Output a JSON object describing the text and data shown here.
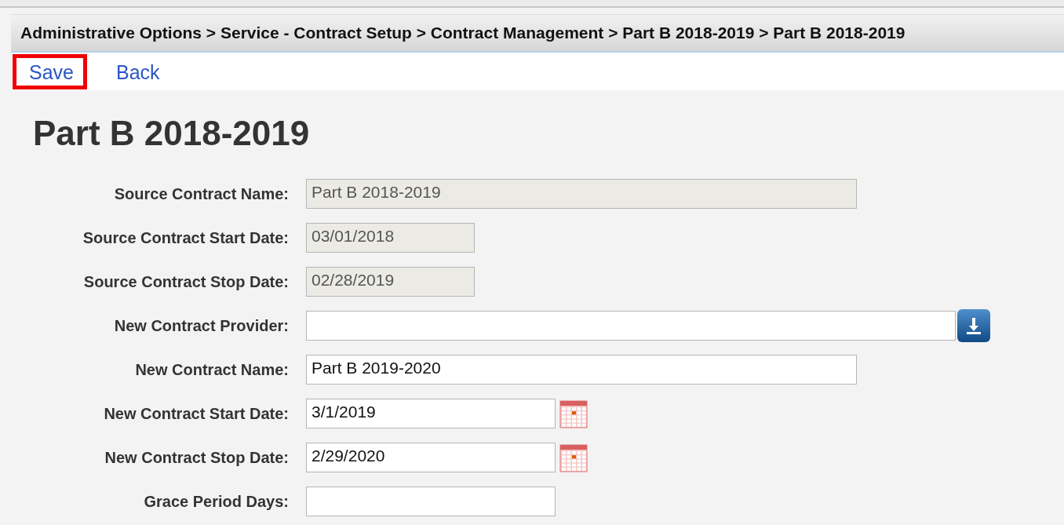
{
  "breadcrumb": "Administrative Options > Service - Contract Setup > Contract Management > Part B 2018-2019 > Part B 2018-2019",
  "actions": [
    {
      "label": "Save",
      "highlighted": true
    },
    {
      "label": "Back",
      "highlighted": false
    }
  ],
  "heading": "Part B 2018-2019",
  "fields": [
    {
      "label": "Source Contract Name:",
      "kind": "readonly",
      "value": "Part B 2018-2019"
    },
    {
      "label": "Source Contract Start Date:",
      "kind": "readonly-date",
      "value": "03/01/2018"
    },
    {
      "label": "Source Contract Stop Date:",
      "kind": "readonly-date",
      "value": "02/28/2019"
    },
    {
      "label": "New Contract Provider:",
      "kind": "lookup"
    },
    {
      "label": "New Contract Name:",
      "kind": "text",
      "value": "Part B 2019-2020"
    },
    {
      "label": "New Contract Start Date:",
      "kind": "date",
      "value": "3/1/2019"
    },
    {
      "label": "New Contract Stop Date:",
      "kind": "date",
      "value": "2/29/2020"
    },
    {
      "label": "Grace Period Days:",
      "kind": "number"
    }
  ]
}
